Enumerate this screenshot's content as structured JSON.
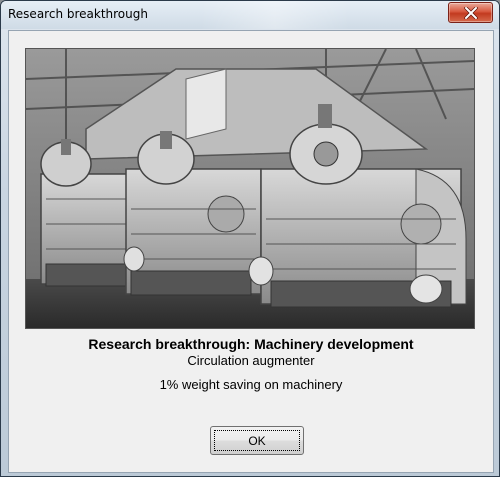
{
  "window": {
    "title": "Research breakthrough"
  },
  "dialog": {
    "headline": "Research breakthrough: Machinery development",
    "subtitle": "Circulation augmenter",
    "effect": "1% weight saving on machinery",
    "ok_label": "OK"
  },
  "icons": {
    "close": "close-icon"
  },
  "colors": {
    "close_button": "#c8432a",
    "dialog_background": "#f0f0f0"
  }
}
